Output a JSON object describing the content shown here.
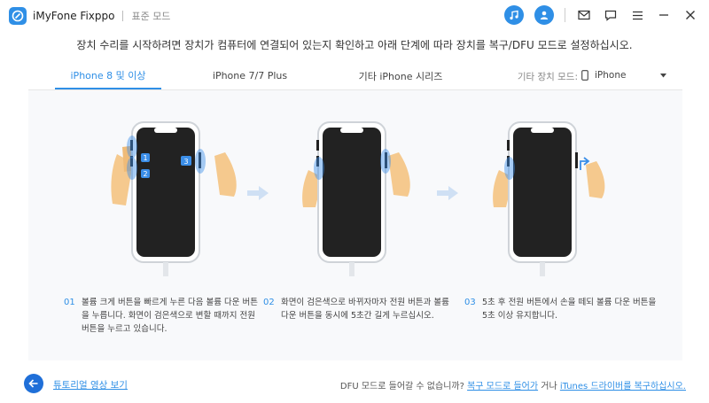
{
  "titlebar": {
    "app_name": "iMyFone Fixppo",
    "mode": "표준 모드",
    "icons": [
      "music-note-icon",
      "user-icon",
      "mail-icon",
      "chat-icon",
      "menu-icon",
      "minimize-icon",
      "close-icon"
    ]
  },
  "instruction": "장치 수리를 시작하려면 장치가 컴퓨터에 연결되어 있는지 확인하고 아래 단계에 따라 장치를 복구/DFU 모드로 설정하십시오.",
  "tabs": [
    {
      "label": "iPhone 8  및 이상",
      "active": true
    },
    {
      "label": "iPhone 7/7 Plus",
      "active": false
    },
    {
      "label": "기타 iPhone 시리즈",
      "active": false
    }
  ],
  "other_mode": {
    "label": "기타 장치 모드:",
    "selected": "iPhone"
  },
  "steps": [
    {
      "num": "01",
      "text": "볼륨 크게 버튼을 빠르게 누른 다음 볼륨 다운 버튼을 누릅니다. 화면이 검은색으로 변할 때까지 전원 버튼을 누르고 있습니다."
    },
    {
      "num": "02",
      "text": "화면이 검은색으로 바뀌자마자 전원 버튼과 볼륨 다운 버튼을 동시에 5초간 길게 누르십시오."
    },
    {
      "num": "03",
      "text": "5초 후 전원 버튼에서 손을 떼되 볼륨 다운 버튼을 5초 이상 유지합니다."
    }
  ],
  "badges": [
    "1",
    "2",
    "3"
  ],
  "footer": {
    "tutorial": "튜토리얼 영상 보기",
    "prefix": "DFU 모드로 들어갈 수 없습니까?",
    "link1": "복구 모드로 들어가",
    "middle": "거나",
    "link2": "iTunes 드라이버를 복구하십시오."
  },
  "colors": {
    "accent": "#2f8fe6",
    "panel": "#f8f9fb",
    "skin": "#f5c98e",
    "press": "#3b8ee8"
  }
}
